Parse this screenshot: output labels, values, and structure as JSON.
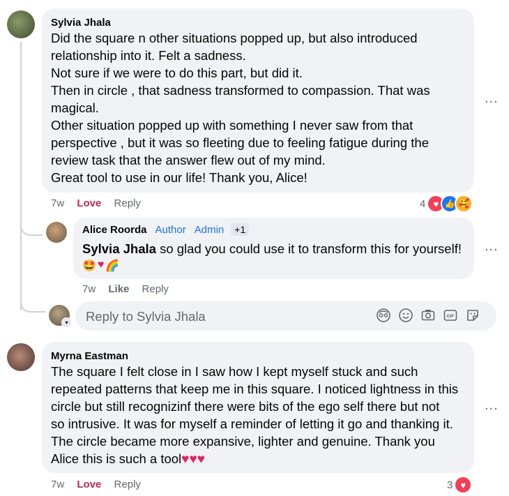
{
  "comments": [
    {
      "author": "Sylvia Jhala",
      "text": "Did the square n other situations popped up, but also introduced\nrelationship into it. Felt a sadness.\nNot sure if we were to do this part, but did it.\nThen in circle , that sadness transformed to compassion. That was\nmagical.\nOther situation popped up with something I never saw from that\nperspective , but it was so fleeting due to feeling fatigue during the\nreview task that the answer flew out of my mind.\nGreat tool to use in our life! Thank you, Alice!",
      "time": "7w",
      "reaction_label": "Love",
      "reply_label": "Reply",
      "reaction_count": "4",
      "more_label": "..."
    },
    {
      "author": "Myrna Eastman",
      "text": "The square I felt close in I saw how I kept myself stuck and such\nrepeated patterns that keep me in this square. I noticed lightness in this\ncircle but still recognizinf there were bits of the ego self there but not\nso intrusive. It was for myself a reminder of letting it go and thanking it.\nThe circle became more expansive, lighter and genuine. Thank you\nAlice this is such a tool",
      "time": "7w",
      "reaction_label": "Love",
      "reply_label": "Reply",
      "reaction_count": "3",
      "more_label": "..."
    }
  ],
  "reply": {
    "author": "Alice Roorda",
    "badges": [
      "Author",
      "Admin"
    ],
    "badge_extra": "+1",
    "mention": "Sylvia Jhala",
    "text": "so glad you could use it to transform this for yourself!",
    "time": "7w",
    "like_label": "Like",
    "reply_label": "Reply",
    "more_label": "..."
  },
  "reply_box": {
    "placeholder": "Reply to Sylvia Jhala"
  },
  "icons": [
    "avatar-sticker-icon",
    "emoji-icon",
    "camera-icon",
    "gif-icon",
    "sticker-icon"
  ],
  "colors": {
    "love": "#c2284c",
    "link": "#1b74e4",
    "bubble": "#f0f2f5",
    "muted": "#65676b"
  }
}
